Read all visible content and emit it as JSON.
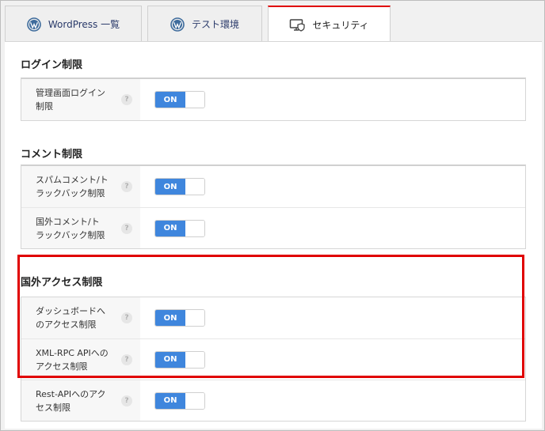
{
  "tabs": [
    {
      "label": "WordPress 一覧",
      "icon": "wordpress-icon",
      "active": false
    },
    {
      "label": "テスト環境",
      "icon": "wordpress-icon",
      "active": false
    },
    {
      "label": "セキュリティ",
      "icon": "monitor-shield-icon",
      "active": true
    }
  ],
  "sections": [
    {
      "title": "ログイン制限",
      "rows": [
        {
          "label": "管理画面ログイン\n制限",
          "help": "?",
          "toggle": "ON"
        }
      ]
    },
    {
      "title": "コメント制限",
      "rows": [
        {
          "label": "スパムコメント/ト\nラックバック制限",
          "help": "?",
          "toggle": "ON"
        },
        {
          "label": "国外コメント/ト\nラックバック制限",
          "help": "?",
          "toggle": "ON"
        }
      ]
    },
    {
      "title": "国外アクセス制限",
      "rows": [
        {
          "label": "ダッシュボードへ\nのアクセス制限",
          "help": "?",
          "toggle": "ON"
        },
        {
          "label": "XML-RPC APIへの\nアクセス制限",
          "help": "?",
          "toggle": "ON"
        },
        {
          "label": "Rest-APIへのアク\nセス制限",
          "help": "?",
          "toggle": "ON"
        }
      ]
    }
  ],
  "colors": {
    "accent_red": "#e00000",
    "toggle_on": "#3f86dd",
    "tab_text": "#2a3a6a"
  }
}
